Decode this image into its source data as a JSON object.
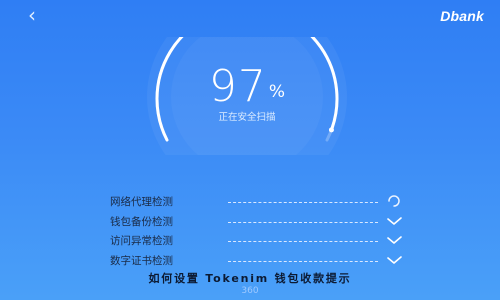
{
  "header": {
    "back_icon": "chevron-left-icon",
    "brand": "Dbank"
  },
  "scan": {
    "percent": "97",
    "percent_sign": "%",
    "progress_fraction": 0.97,
    "label": "正在安全扫描"
  },
  "checks": [
    {
      "label": "网络代理检测",
      "status": "checking",
      "icon": "spinner-icon"
    },
    {
      "label": "钱包备份检测",
      "status": "done",
      "icon": "check-icon"
    },
    {
      "label": "访问异常检测",
      "status": "done",
      "icon": "check-icon"
    },
    {
      "label": "数字证书检测",
      "status": "done",
      "icon": "check-icon"
    }
  ],
  "footer": {
    "title": "如何设置 Tokenim 钱包收款提示",
    "ghost_text": "360"
  },
  "colors": {
    "background_top": "#2f7ef4",
    "background_bottom": "#4aa0f8",
    "ring": "#ffffff",
    "check_text": "#1a2b47"
  }
}
